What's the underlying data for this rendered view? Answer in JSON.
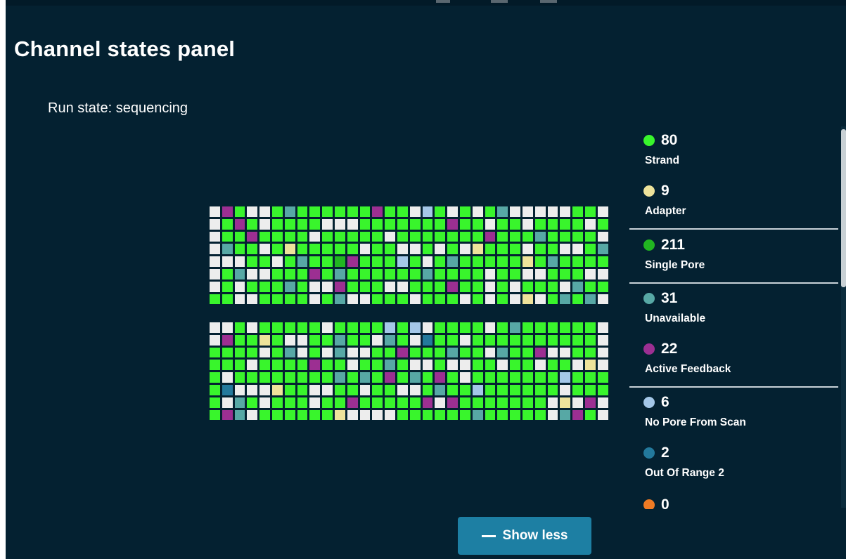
{
  "panel": {
    "title": "Channel states panel",
    "run_state": "Run state: sequencing"
  },
  "colors": {
    "background": "#042131",
    "strand": "#39f52c",
    "adapter": "#eee39b",
    "single_pore": "#21b521",
    "unavailable": "#57a8a5",
    "active_feedback": "#9c2f92",
    "no_pore_from_scan": "#a4c7e8",
    "out_of_range_2": "#23799c",
    "zero_state": "#ef7b24",
    "empty": "#ededed",
    "button": "#1d7fa3"
  },
  "legend": [
    {
      "count": "80",
      "label": "Strand",
      "color": "#39f52c",
      "icon": "strand-dot-icon"
    },
    {
      "count": "9",
      "label": "Adapter",
      "color": "#eee39b",
      "icon": "adapter-dot-icon"
    },
    {
      "count": "211",
      "label": "Single Pore",
      "color": "#21b521",
      "icon": "single-pore-dot-icon"
    },
    {
      "count": "31",
      "label": "Unavailable",
      "color": "#57a8a5",
      "icon": "unavailable-dot-icon"
    },
    {
      "count": "22",
      "label": "Active Feedback",
      "color": "#9c2f92",
      "icon": "active-feedback-dot-icon"
    },
    {
      "count": "6",
      "label": "No Pore From Scan",
      "color": "#a4c7e8",
      "icon": "no-pore-dot-icon"
    },
    {
      "count": "2",
      "label": "Out Of Range 2",
      "color": "#23799c",
      "icon": "out-of-range-dot-icon"
    },
    {
      "count": "0",
      "label": "",
      "color": "#ef7b24",
      "icon": "partial-dot-icon"
    }
  ],
  "button": {
    "show_less_label": "Show less",
    "icon": "minus-icon"
  },
  "grids": {
    "legend_key": {
      "G": "Strand",
      "D": "Single Pore",
      "W": "Empty",
      "T": "Unavailable",
      "P": "Active Feedback",
      "Y": "Adapter",
      "L": "No Pore From Scan",
      "B": "Out Of Range 2"
    },
    "top": [
      "WPGWWGTGGGGGGPGGWLGWGWGTWWWWWGGW",
      "WGPGWGGGGWWWGGGGGGGPGGWGGWGGGGWG",
      "WGGPGGGGWGGGGGWGGGGGGGPGGGTGGGGW",
      "WTGGWGYGGGGGWGGWWGWGWYGGGWGGWWGT",
      "WWWGGWGTGGDPGGGLGWGTGGGGGYGTGGGG",
      "WGTWWGGGPGTGGGGGGTGGGGWGGWWGGGWW",
      "WGWGGGTGWWPGGGWWGGGPGGWGWGGGWTGG",
      "GGWWGGGGWGTWWGGGWGGGWGWGWYWGTGTW"
    ],
    "bottom": [
      "WWGWGGGGGWGGGGLGLWGGGGWGTGGGGGGW",
      "WPGGYGWWGGTGGWTGWBGGWGGGGGGGGGGW",
      "GGGGWGTWGWTWWGGPGGGTGGWTGGPWWGGW",
      "GGGWGGGGPGGWGGTGWWGWWGGWGGWGGWYW",
      "GWGGGGGGGGTGTGPGTGPGWGGGGGGGLGGG",
      "GBWWWYGGWWGGWGGWWGTGGLGGGGGGWGGG",
      "GWTGWGGGWGGPGGGGGPWPGGGGGGGWYWPW",
      "GPTWGGGGGGYWWWWGGGGGGTGGGGGWTPGW"
    ]
  }
}
